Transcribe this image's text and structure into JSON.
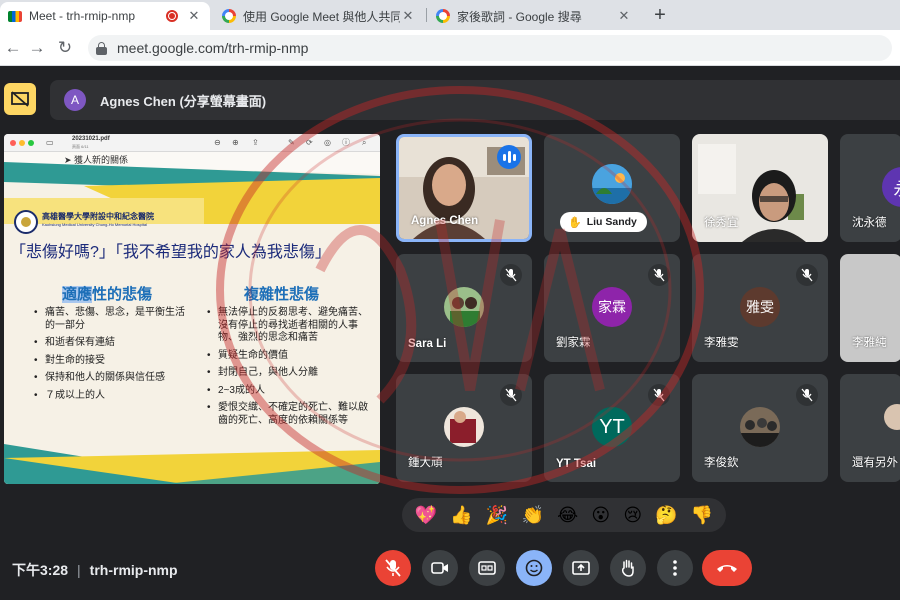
{
  "browser": {
    "tabs": [
      {
        "title": "Meet - trh-rmip-nmp",
        "icon": "meet-icon",
        "active": true,
        "recording": true
      },
      {
        "title": "使用 Google Meet 與他人共同",
        "icon": "google-icon",
        "active": false
      },
      {
        "title": "家後歌詞 - Google 搜尋",
        "icon": "google-icon",
        "active": false
      }
    ],
    "url": "meet.google.com/trh-rmip-nmp"
  },
  "meet": {
    "presenter_label": "Agnes Chen (分享螢幕畫面)",
    "presenter_initial": "A",
    "meeting_code": "trh-rmip-nmp",
    "time": "下午3:28"
  },
  "shared_screen": {
    "pdf_filename": "20231021.pdf",
    "pdf_page": "頁面 6/11",
    "prev_line": "➤ 獲人新的關係",
    "hospital_name": "高雄醫學大學附設中和紀念醫院",
    "hospital_en": "Kaohsiung Medical University Chung-Ho Memorial Hospital",
    "slide_title": "「悲傷好嗎?」「我不希望我的家人為我悲傷」",
    "left_col": {
      "title_hl": "適應",
      "title_rest": "性的悲傷",
      "items": [
        "痛苦、悲傷、思念，是平衡生活的一部分",
        "和逝者保有連結",
        "對生命的接受",
        "保持和他人的關係與信任感",
        "７成以上的人"
      ]
    },
    "right_col": {
      "title": "複雜性悲傷",
      "items": [
        "無法停止的反芻思考、避免痛苦、沒有停止的尋找逝者相關的人事物、強烈的思念和痛苦",
        "質疑生命的價值",
        "封閉自己，與他人分離",
        "2~3成的人",
        "愛恨交織、不確定的死亡、難以啟齒的死亡、高度的依賴關係等"
      ]
    },
    "colors": {
      "title_blue": "#1b2a7a",
      "heading_blue": "#1d6fb8",
      "teal": "#2f9a94",
      "yellow": "#f2d33a"
    }
  },
  "participants": [
    {
      "name": "Agnes Chen",
      "type": "video",
      "speaking": true
    },
    {
      "name": "Liu Sandy",
      "type": "photo",
      "hand_raised": true
    },
    {
      "name": "徐秀宜",
      "type": "video"
    },
    {
      "name": "沈永德",
      "type": "initial",
      "initial": "永",
      "color": "#5e35b1"
    },
    {
      "name": "Sara Li",
      "type": "photo",
      "muted": true
    },
    {
      "name": "劉家霖",
      "type": "initial",
      "initial": "家霖",
      "color": "#8e24aa",
      "muted": true
    },
    {
      "name": "李雅雯",
      "type": "initial",
      "initial": "雅雯",
      "color": "#5d3a2e",
      "muted": true
    },
    {
      "name": "李雅純",
      "type": "video"
    },
    {
      "name": "鍾大頑",
      "type": "photo",
      "muted": true
    },
    {
      "name": "YT Tsai",
      "type": "initial",
      "initial": "YT",
      "color": "#00695c",
      "muted": true
    },
    {
      "name": "李俊欽",
      "type": "photo",
      "muted": true
    },
    {
      "name": "還有另外",
      "type": "overflow"
    }
  ],
  "reactions": [
    "💖",
    "👍",
    "🎉",
    "👏",
    "😂",
    "😮",
    "😢",
    "🤔",
    "👎"
  ],
  "controls": [
    "mic-off",
    "camera",
    "captions",
    "reactions",
    "present",
    "raise-hand",
    "more",
    "end-call"
  ]
}
